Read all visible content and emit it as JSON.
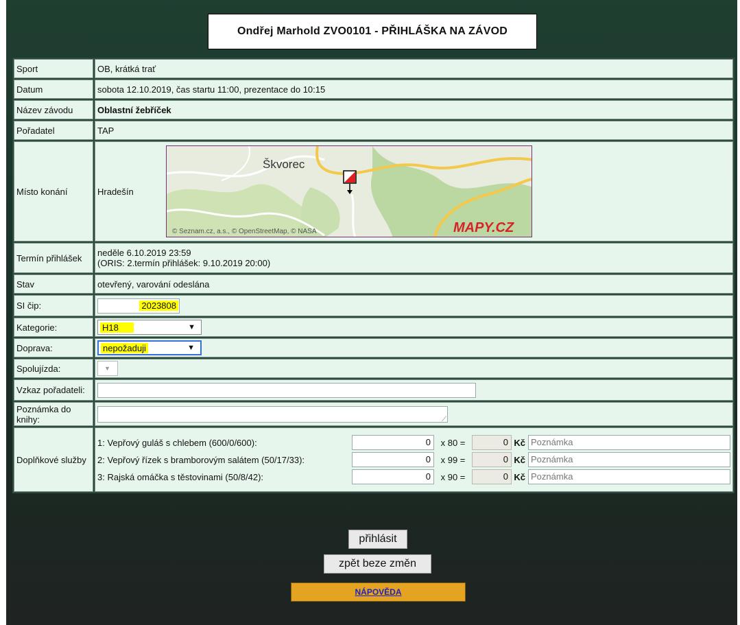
{
  "title": "Ondřej Marhold ZVO0101 - PŘIHLÁŠKA NA ZÁVOD",
  "rows": {
    "sport": {
      "label": "Sport",
      "value": "OB, krátká trať"
    },
    "date": {
      "label": "Datum",
      "value": "sobota 12.10.2019, čas startu 11:00, prezentace do 10:15"
    },
    "race_name": {
      "label": "Název závodu",
      "value": "Oblastní žebříček"
    },
    "organizer": {
      "label": "Pořadatel",
      "value": "TAP"
    },
    "venue": {
      "label": "Místo konání",
      "value": "Hradešín",
      "map_place": "Škvorec",
      "map_credits": "© Seznam.cz, a.s., © OpenStreetMap, © NASA",
      "map_logo": "MAPY.CZ"
    },
    "deadline": {
      "label": "Termín přihlášek",
      "line1": "neděle 6.10.2019 23:59",
      "line2": "(ORIS: 2.termín přihlášek: 9.10.2019 20:00)"
    },
    "status": {
      "label": "Stav",
      "value": "otevřený, varování odeslána"
    },
    "si": {
      "label": "SI čip:",
      "value": "2023808"
    },
    "category": {
      "label": "Kategorie:",
      "value": "H18"
    },
    "transport": {
      "label": "Doprava:",
      "value": "nepožaduji"
    },
    "carpool": {
      "label": "Spolujízda:",
      "value": ""
    },
    "message": {
      "label": "Vzkaz pořadateli:",
      "value": ""
    },
    "book_note": {
      "label": "Poznámka do knihy:",
      "value": ""
    },
    "services": {
      "label": "Doplňkové služby",
      "currency": "Kč",
      "placeholder": "Poznámka",
      "items": [
        {
          "name": "1: Vepřový guláš s chlebem (600/0/600):",
          "qty": "0",
          "price_text": "x 80 =",
          "total": "0"
        },
        {
          "name": "2: Vepřový řízek s bramborovým salátem (50/17/33):",
          "qty": "0",
          "price_text": "x 99 =",
          "total": "0"
        },
        {
          "name": "3: Rajská omáčka s těstovinami (50/8/42):",
          "qty": "0",
          "price_text": "x 90 =",
          "total": "0"
        }
      ]
    }
  },
  "buttons": {
    "submit": "přihlásit",
    "back": "zpět beze změn",
    "help": "NÁPOVĚDA"
  },
  "colors": {
    "panel": "#e7f6ec",
    "highlight": "#ffff00",
    "help_bg": "#e5a322",
    "background": "#1b3329"
  }
}
